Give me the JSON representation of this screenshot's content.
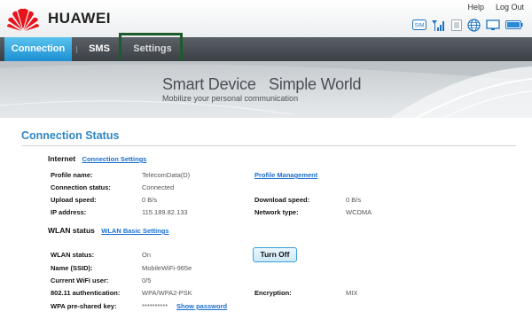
{
  "brand": {
    "name": "HUAWEI"
  },
  "toplinks": {
    "help": "Help",
    "logout": "Log Out"
  },
  "status_icons": [
    "sim-icon",
    "signal-icon",
    "sms-status-icon",
    "globe-icon",
    "display-icon",
    "battery-icon"
  ],
  "nav": {
    "connection": "Connection",
    "sms": "SMS",
    "settings": "Settings"
  },
  "banner": {
    "title": "Smart Device   Simple World",
    "subtitle": "Mobilize your personal communication"
  },
  "page": {
    "title": "Connection Status",
    "internet": {
      "heading": "Internet",
      "settings_link": "Connection Settings",
      "profile_label": "Profile name:",
      "profile_value": "TelecomData(D)",
      "profile_link": "Profile Management",
      "conn_status_label": "Connection status:",
      "conn_status_value": "Connected",
      "upload_label": "Upload speed:",
      "upload_value": "0 B/s",
      "download_label": "Download speed:",
      "download_value": "0 B/s",
      "ip_label": "IP address:",
      "ip_value": "115.189.82.133",
      "network_label": "Network type:",
      "network_value": "WCDMA"
    },
    "wlan": {
      "heading": "WLAN status",
      "settings_link": "WLAN Basic Settings",
      "status_label": "WLAN status:",
      "status_value": "On",
      "toggle_button": "Turn Off",
      "ssid_label": "Name (SSID):",
      "ssid_value": "MobileWiFi-965e",
      "users_label": "Current WiFi user:",
      "users_value": "0/5",
      "auth_label": "802.11 authentication:",
      "auth_value": "WPA/WPA2-PSK",
      "enc_label": "Encryption:",
      "enc_value": "MIX",
      "psk_label": "WPA pre-shared key:",
      "psk_value": "**********",
      "show_password": "Show password"
    }
  },
  "colors": {
    "accent_blue": "#2f86c6",
    "link_blue": "#1a6fd0",
    "nav_active": "#1b8fd3",
    "nav_bg": "#3b4046",
    "highlight_box": "#1d5a2c"
  }
}
